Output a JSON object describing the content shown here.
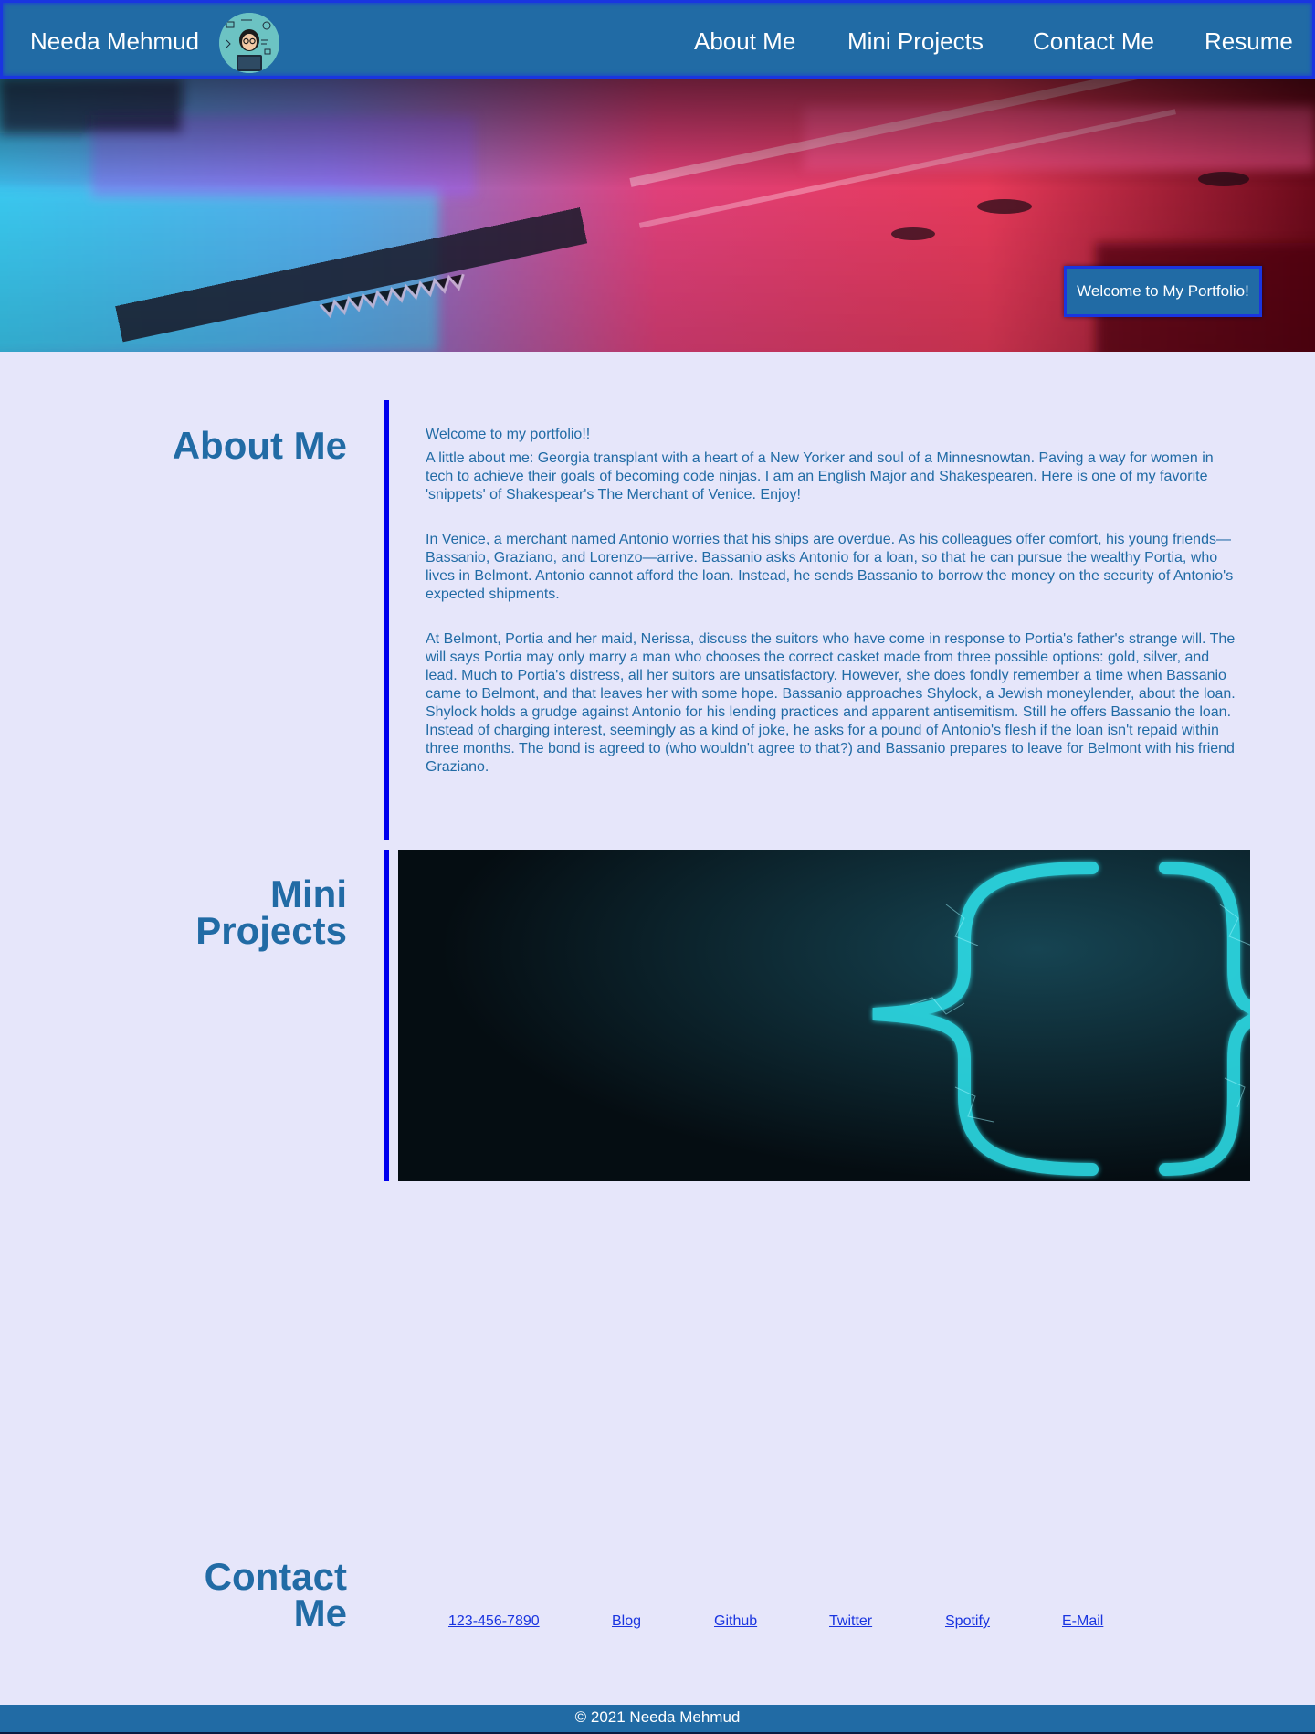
{
  "header": {
    "brand": "Needa Mehmud",
    "nav": [
      "About Me",
      "Mini Projects",
      "Contact Me",
      "Resume"
    ],
    "avatar_icon": "coder-avatar-icon"
  },
  "hero": {
    "welcome": "Welcome to My Portfolio!",
    "image": "circuit-board-photo"
  },
  "about": {
    "title": "About Me",
    "paragraphs": [
      "Welcome to my portfolio!!",
      "A little about me: Georgia transplant with a heart of a New Yorker and soul of a Minnesnowtan. Paving a way for women in tech to achieve their goals of becoming code ninjas. I am an English Major and Shakespearen. Here is one of my favorite 'snippets' of Shakespear's The Merchant of Venice. Enjoy!",
      "In Venice, a merchant named Antonio worries that his ships are overdue. As his colleagues offer comfort, his young friends—Bassanio, Graziano, and Lorenzo—arrive. Bassanio asks Antonio for a loan, so that he can pursue the wealthy Portia, who lives in Belmont. Antonio cannot afford the loan. Instead, he sends Bassanio to borrow the money on the security of Antonio's expected shipments.",
      "At Belmont, Portia and her maid, Nerissa, discuss the suitors who have come in response to Portia's father's strange will. The will says Portia may only marry a man who chooses the correct casket made from three possible options: gold, silver, and lead. Much to Portia's distress, all her suitors are unsatisfactory. However, she does fondly remember a time when Bassanio came to Belmont, and that leaves her with some hope. Bassanio approaches Shylock, a Jewish moneylender, about the loan. Shylock holds a grudge against Antonio for his lending practices and apparent antisemitism. Still he offers Bassanio the loan. Instead of charging interest, seemingly as a kind of joke, he asks for a pound of Antonio's flesh if the loan isn't repaid within three months. The bond is agreed to (who wouldn't agree to that?) and Bassanio prepares to leave for Belmont with his friend Graziano."
    ]
  },
  "projects": {
    "title": "Mini Projects",
    "image": "code-braces-image"
  },
  "contact": {
    "title": "Contact Me",
    "links": [
      "123-456-7890",
      "Blog",
      "Github",
      "Twitter",
      "Spotify",
      "E-Mail"
    ]
  },
  "footer": {
    "text": "© 2021 Needa Mehmud"
  },
  "colors": {
    "primary": "#216ba5",
    "accent_border": "#1a35e0",
    "background": "#e6e6fa",
    "bar": "#0000ee"
  }
}
